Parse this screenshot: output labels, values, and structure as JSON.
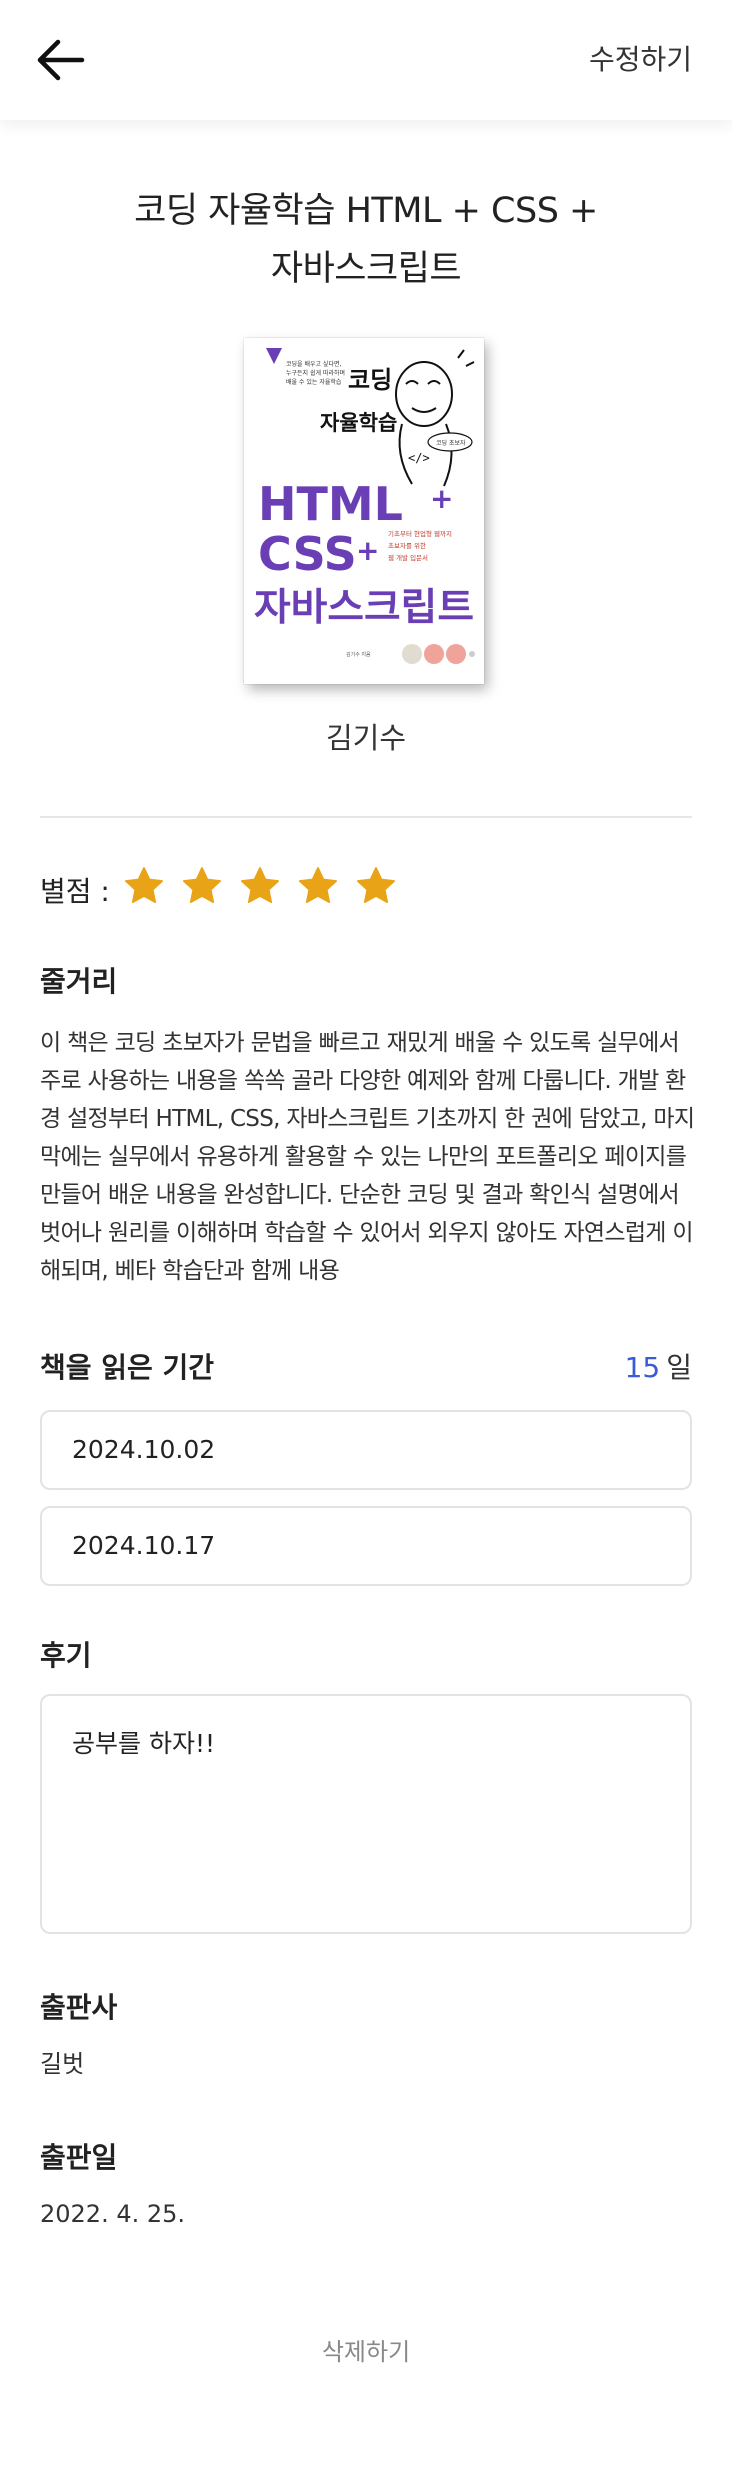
{
  "header": {
    "edit_label": "수정하기"
  },
  "book": {
    "title_line1": "코딩 자율학습 HTML + CSS +",
    "title_line2": "자바스크립트",
    "author": "김기수",
    "cover": {
      "top_blurb_1": "코딩을 배우고 싶다면,",
      "top_blurb_2": "누구든지 쉽게 따라하며",
      "top_blurb_3": "배울 수 있는 자율학습",
      "brand_1": "코딩",
      "brand_2": "자율학습",
      "big_1": "HTML",
      "big_2": "CSS",
      "big_3": "자바스크립트",
      "side_1": "기초부터 현업형 웹까지",
      "side_2": "초보자를 위한",
      "side_3": "웹 개발 입문서",
      "bubble": "코딩 초보자",
      "bottom_author": "김기수 지음",
      "accent_color": "#6a3fb5"
    }
  },
  "rating": {
    "label": "별점 :",
    "value": 5,
    "max": 5,
    "star_color": "#e8a317"
  },
  "summary": {
    "title": "줄거리",
    "lines": [
      "이 책은 코딩 초보자가 문법을 빠르고 재밌게 배울 수 있도록 실무에서",
      "주로 사용하는 내용을 쏙쏙 골라 다양한 예제와 함께 다룹니다. 개발 환",
      "경 설정부터 HTML, CSS, 자바스크립트 기초까지 한 권에 담았고, 마지",
      "막에는 실무에서 유용하게 활용할 수 있는 나만의 포트폴리오 페이지를",
      "만들어 배운 내용을 완성합니다. 단순한 코딩 및 결과 확인식 설명에서",
      "벗어나 원리를 이해하며 학습할 수 있어서 외우지 않아도 자연스럽게 이",
      "해되며, 베타 학습단과 함께 내용"
    ]
  },
  "reading_period": {
    "title": "책을 읽은 기간",
    "days": "15",
    "days_unit": "일",
    "start_date": "2024.10.02",
    "end_date": "2024.10.17"
  },
  "review": {
    "title": "후기",
    "text": "공부를 하자!!"
  },
  "publisher": {
    "title": "출판사",
    "value": "길벗"
  },
  "published_date": {
    "title": "출판일",
    "value": "2022. 4. 25."
  },
  "delete_label": "삭제하기"
}
